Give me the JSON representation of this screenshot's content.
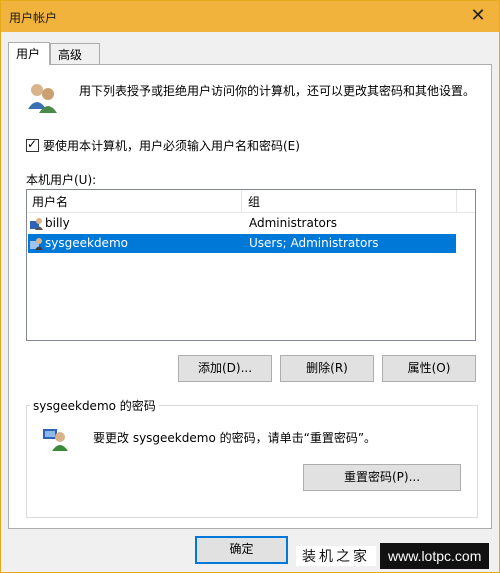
{
  "window": {
    "title": "用户帐户",
    "close_glyph": "✕"
  },
  "tabs": [
    {
      "label": "用户"
    },
    {
      "label": "高级"
    }
  ],
  "description": "用下列表授予或拒绝用户访问你的计算机，还可以更改其密码和其他设置。",
  "require_login": {
    "label": "要使用本计算机，用户必须输入用户名和密码(E)",
    "checked": true
  },
  "users": {
    "label": "本机用户(U):",
    "columns": [
      "用户名",
      "组"
    ],
    "rows": [
      {
        "name": "billy",
        "group": "Administrators"
      },
      {
        "name": "sysgeekdemo",
        "group": "Users; Administrators",
        "selected": true
      }
    ]
  },
  "buttons": {
    "add": "添加(D)...",
    "remove": "删除(R)",
    "properties": "属性(O)"
  },
  "password": {
    "group_label": "sysgeekdemo 的密码",
    "text": "要更改 sysgeekdemo 的密码，请单击“重置密码”。",
    "reset_button": "重置密码(P)..."
  },
  "footer": {
    "ok_button": "确定"
  },
  "watermark": {
    "text1": "装机之家",
    "text2": "www.lotpc.com"
  },
  "colors": {
    "titlebar": "#f2b33d",
    "selection": "#0078d7",
    "accent_border": "#0078d7"
  }
}
